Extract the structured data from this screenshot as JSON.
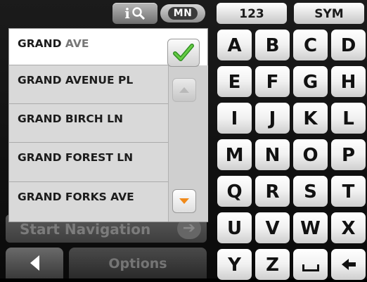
{
  "header": {
    "info_label": "i",
    "state_badge": "MN"
  },
  "results": {
    "items": [
      {
        "main": "GRAND ",
        "suffix": "AVE"
      },
      {
        "main": "GRAND AVENUE PL",
        "suffix": ""
      },
      {
        "main": "GRAND BIRCH LN",
        "suffix": ""
      },
      {
        "main": "GRAND FOREST LN",
        "suffix": ""
      },
      {
        "main": "GRAND FORKS AVE",
        "suffix": ""
      }
    ]
  },
  "actions": {
    "start_navigation": "Start Navigation",
    "options": "Options"
  },
  "keyboard": {
    "mode_numbers": "123",
    "mode_symbols": "SYM",
    "keys": [
      "A",
      "B",
      "C",
      "D",
      "E",
      "F",
      "G",
      "H",
      "I",
      "J",
      "K",
      "L",
      "M",
      "N",
      "O",
      "P",
      "Q",
      "R",
      "S",
      "T",
      "U",
      "V",
      "W",
      "X",
      "Y",
      "Z"
    ]
  },
  "colors": {
    "check": "#3aa52a",
    "down_arrow": "#f08a1a"
  }
}
